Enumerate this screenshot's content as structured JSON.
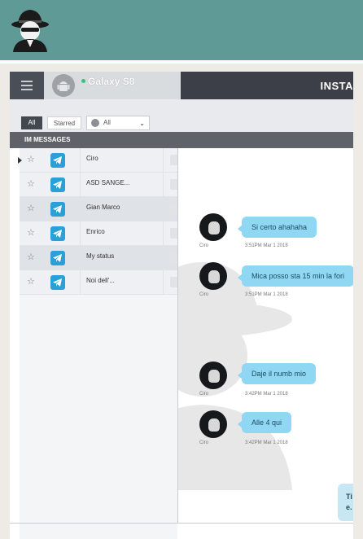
{
  "header": {
    "device_name": "Galaxy S8",
    "app_title": "INSTA"
  },
  "filters": {
    "all_label": "All",
    "starred_label": "Starred",
    "select_value": "All"
  },
  "section": {
    "title": "IM MESSAGES"
  },
  "conversations": [
    {
      "name": "Ciro"
    },
    {
      "name": "ASD SANGE..."
    },
    {
      "name": "Gian Marco"
    },
    {
      "name": "Enrico"
    },
    {
      "name": "My status"
    },
    {
      "name": "Noi dell'..."
    }
  ],
  "messages": [
    {
      "sender": "Ciro",
      "text": "Si certo ahahaha",
      "time": "3:51PM Mar 1 2018"
    },
    {
      "sender": "Ciro",
      "text": "Mica posso sta 15 min la fori",
      "time": "3:51PM Mar 1 2018"
    },
    {
      "sender": "Ciro",
      "text": "Daje il numb mio",
      "time": "3:42PM Mar 1 2018"
    },
    {
      "sender": "Ciro",
      "text": "Alle 4 qui",
      "time": "3:42PM Mar 1 2018"
    }
  ],
  "outgoing_fragment": {
    "line1": "Ti",
    "line2": "e."
  },
  "colors": {
    "topbar": "#5f9a96",
    "bubble": "#8fd7f2",
    "telegram": "#2a9fd8"
  }
}
